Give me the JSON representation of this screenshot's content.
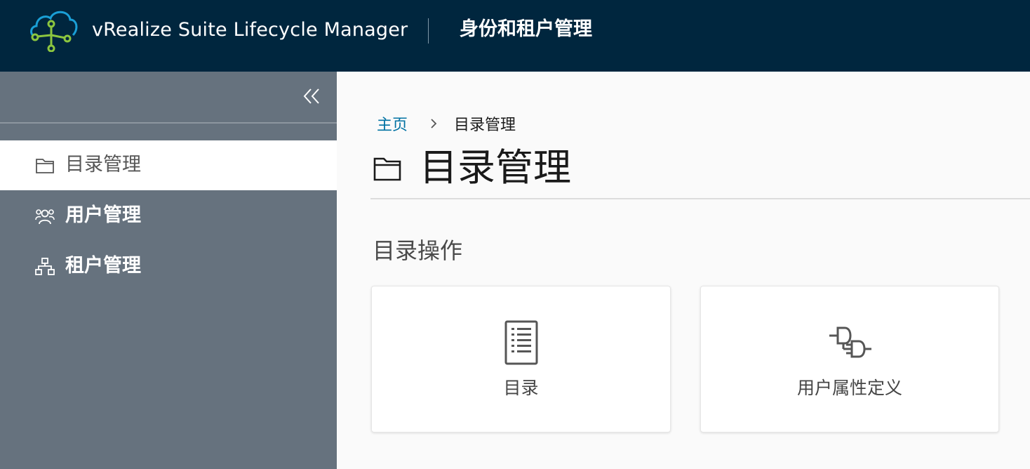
{
  "header": {
    "app_title": "vRealize Suite Lifecycle Manager",
    "section_title": "身份和租户管理",
    "colors": {
      "background": "#00263e",
      "logo_blue": "#1a9fd6",
      "logo_green": "#8cc63f"
    }
  },
  "sidebar": {
    "collapse_icon": "double-chevron-left-icon",
    "items": [
      {
        "label": "目录管理",
        "icon": "folder-icon",
        "active": true
      },
      {
        "label": "用户管理",
        "icon": "users-icon",
        "active": false
      },
      {
        "label": "租户管理",
        "icon": "org-chart-icon",
        "active": false
      }
    ]
  },
  "breadcrumb": {
    "home": "主页",
    "current": "目录管理"
  },
  "page": {
    "title": "目录管理",
    "title_icon": "folder-icon",
    "section": "目录操作"
  },
  "cards": [
    {
      "label": "目录",
      "icon": "list-document-icon"
    },
    {
      "label": "用户属性定义",
      "icon": "plug-connector-icon"
    }
  ]
}
